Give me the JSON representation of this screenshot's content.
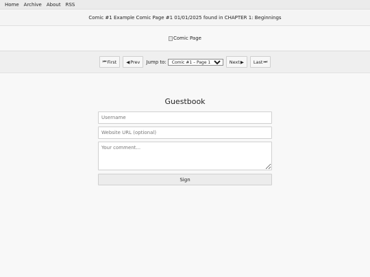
{
  "nav": {
    "home": "Home",
    "archive": "Archive",
    "about": "About",
    "rss": "RSS"
  },
  "comic_info": "Comic #1 Example Comic Page #1 01/01/2025 found in CHAPTER 1: Beginnings",
  "comic_image": {
    "alt": "Comic Page"
  },
  "comic_nav": {
    "first": "First",
    "first_icon": "⏮",
    "prev": "Prev",
    "prev_icon": "◀",
    "jump_label": "Jump to:",
    "jump_selected": "Comic #1 – Page 1",
    "next": "Next",
    "next_icon": "▶",
    "last": "Last",
    "last_icon": "⏭"
  },
  "guestbook": {
    "title": "Guestbook",
    "username_placeholder": "Username",
    "website_placeholder": "Website URL (optional)",
    "comment_placeholder": "Your comment...",
    "sign_label": "Sign"
  }
}
